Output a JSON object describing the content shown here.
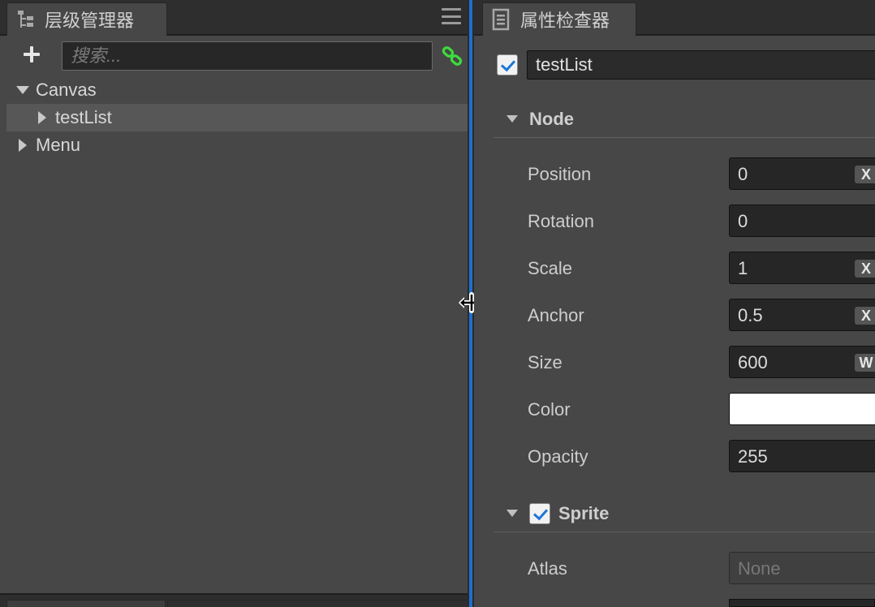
{
  "hierarchy": {
    "tab_title": "层级管理器",
    "search_placeholder": "搜索...",
    "nodes": [
      {
        "label": "Canvas",
        "expanded": true,
        "selected": false
      },
      {
        "label": "testList",
        "expanded": false,
        "selected": true
      },
      {
        "label": "Menu",
        "expanded": false,
        "selected": false
      }
    ]
  },
  "inspector": {
    "tab_title": "属性检查器",
    "node_name": "testList",
    "node_active": true,
    "sections": {
      "node": {
        "title": "Node"
      },
      "sprite": {
        "title": "Sprite",
        "enabled": true
      }
    },
    "properties": {
      "position": {
        "label": "Position",
        "value": "0",
        "axis": "X"
      },
      "rotation": {
        "label": "Rotation",
        "value": "0"
      },
      "scale": {
        "label": "Scale",
        "value": "1",
        "axis": "X"
      },
      "anchor": {
        "label": "Anchor",
        "value": "0.5",
        "axis": "X"
      },
      "size": {
        "label": "Size",
        "value": "600",
        "axis": "W"
      },
      "color": {
        "label": "Color",
        "value": "#ffffff"
      },
      "opacity": {
        "label": "Opacity",
        "value": "255"
      },
      "atlas": {
        "label": "Atlas",
        "value": "None"
      }
    }
  },
  "colors": {
    "accent": "#1f6fd1",
    "panel_bg": "#474747",
    "link_green": "#3ddc3d"
  }
}
